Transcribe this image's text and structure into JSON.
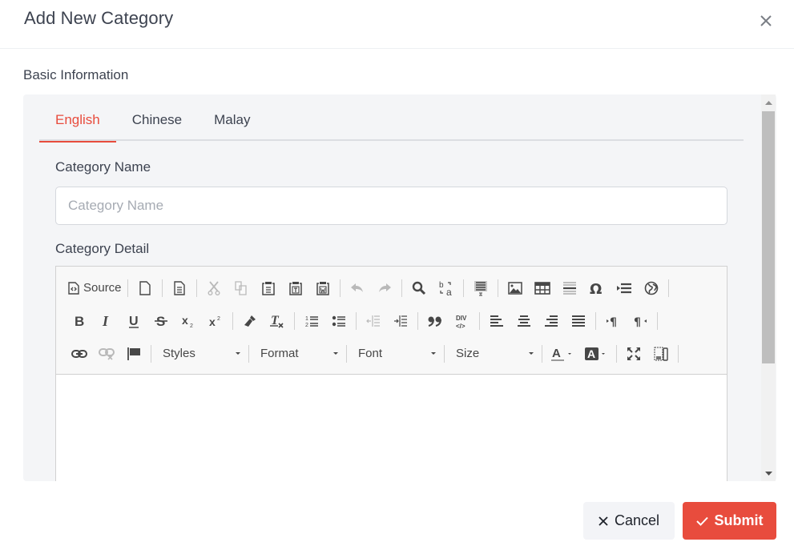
{
  "modal": {
    "title": "Add New Category",
    "close_icon": "close-icon"
  },
  "section": {
    "title": "Basic Information"
  },
  "tabs": [
    {
      "label": "English",
      "active": true
    },
    {
      "label": "Chinese",
      "active": false
    },
    {
      "label": "Malay",
      "active": false
    }
  ],
  "form": {
    "name_label": "Category Name",
    "name_placeholder": "Category Name",
    "name_value": "",
    "detail_label": "Category Detail"
  },
  "editor": {
    "source_label": "Source",
    "row1_icons": [
      "source-icon",
      "new-page-icon",
      "preview-icon",
      "cut-icon",
      "copy-icon",
      "paste-icon",
      "paste-text-icon",
      "paste-word-icon",
      "undo-icon",
      "redo-icon",
      "find-icon",
      "replace-icon",
      "select-all-icon",
      "image-icon",
      "table-icon",
      "horizontal-line-icon",
      "special-char-icon",
      "page-break-icon",
      "iframe-icon"
    ],
    "row2_icons": [
      "bold-icon",
      "italic-icon",
      "underline-icon",
      "strike-icon",
      "subscript-icon",
      "superscript-icon",
      "copy-format-icon",
      "remove-format-icon",
      "numbered-list-icon",
      "bulleted-list-icon",
      "outdent-icon",
      "indent-icon",
      "blockquote-icon",
      "div-icon",
      "align-left-icon",
      "align-center-icon",
      "align-right-icon",
      "justify-icon",
      "ltr-icon",
      "rtl-icon"
    ],
    "row3_icons": [
      "link-icon",
      "unlink-icon",
      "anchor-icon",
      "text-color-icon",
      "bg-color-icon",
      "maximize-icon",
      "show-blocks-icon"
    ],
    "combos": {
      "styles": "Styles",
      "format": "Format",
      "font": "Font",
      "size": "Size"
    }
  },
  "footer": {
    "cancel_label": "Cancel",
    "submit_label": "Submit"
  },
  "colors": {
    "accent": "#e84c3d",
    "text": "#3d4350",
    "panel_bg": "#f4f5f7"
  }
}
